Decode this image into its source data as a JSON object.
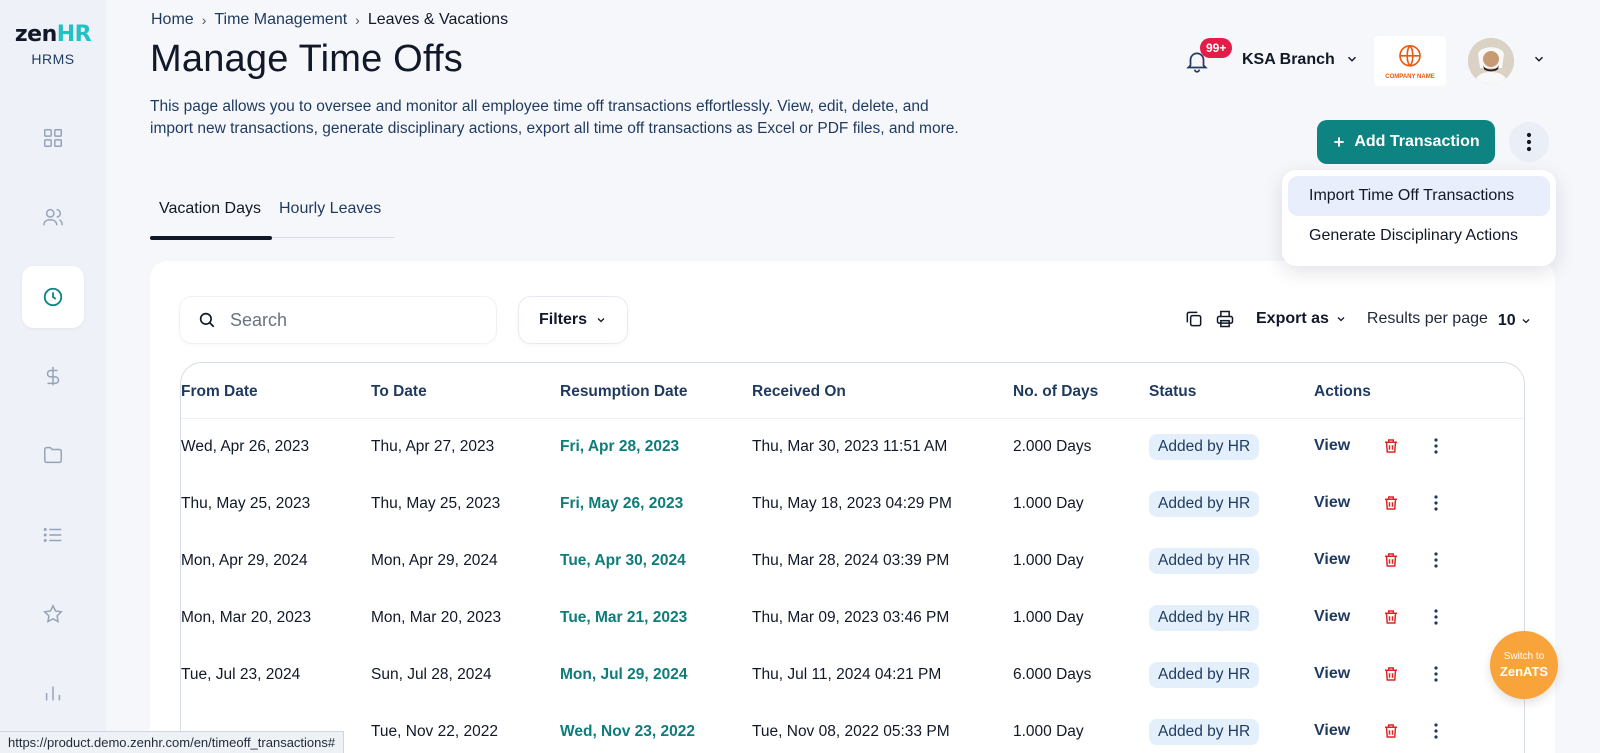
{
  "app": {
    "logo_text_main": "zen",
    "logo_text_accent": "HR",
    "logo_sub": "HRMS"
  },
  "breadcrumb": [
    "Home",
    "Time Management",
    "Leaves & Vacations"
  ],
  "page": {
    "title": "Manage Time Offs",
    "description": "This page allows you to oversee and monitor all employee time off transactions effortlessly. View, edit, delete, and import new transactions, generate disciplinary actions, export all time off transactions as Excel or PDF files, and more."
  },
  "header": {
    "notification_count": "99+",
    "branch": "KSA Branch",
    "company_logo_text": "COMPANY NAME"
  },
  "actions": {
    "add_transaction": "Add Transaction",
    "menu_items": [
      "Import Time Off Transactions",
      "Generate Disciplinary Actions"
    ]
  },
  "tabs": [
    "Vacation Days",
    "Hourly Leaves"
  ],
  "toolbar": {
    "search_placeholder": "Search",
    "filters": "Filters",
    "export_as": "Export as",
    "results_per_page_label": "Results per page",
    "results_per_page_value": "10"
  },
  "table": {
    "columns": [
      "From Date",
      "To Date",
      "Resumption Date",
      "Received On",
      "No. of Days",
      "Status",
      "Actions"
    ],
    "view_label": "View",
    "rows": [
      {
        "from": "Wed, Apr 26, 2023",
        "to": "Thu, Apr 27, 2023",
        "resumption": "Fri, Apr 28, 2023",
        "received": "Thu, Mar 30, 2023 11:51 AM",
        "days": "2.000 Days",
        "status": "Added by HR"
      },
      {
        "from": "Thu, May 25, 2023",
        "to": "Thu, May 25, 2023",
        "resumption": "Fri, May 26, 2023",
        "received": "Thu, May 18, 2023 04:29 PM",
        "days": "1.000 Day",
        "status": "Added by HR"
      },
      {
        "from": "Mon, Apr 29, 2024",
        "to": "Mon, Apr 29, 2024",
        "resumption": "Tue, Apr 30, 2024",
        "received": "Thu, Mar 28, 2024 03:39 PM",
        "days": "1.000 Day",
        "status": "Added by HR"
      },
      {
        "from": "Mon, Mar 20, 2023",
        "to": "Mon, Mar 20, 2023",
        "resumption": "Tue, Mar 21, 2023",
        "received": "Thu, Mar 09, 2023 03:46 PM",
        "days": "1.000 Day",
        "status": "Added by HR"
      },
      {
        "from": "Tue, Jul 23, 2024",
        "to": "Sun, Jul 28, 2024",
        "resumption": "Mon, Jul 29, 2024",
        "received": "Thu, Jul 11, 2024 04:21 PM",
        "days": "6.000 Days",
        "status": "Added by HR"
      },
      {
        "from": "",
        "to": "Tue, Nov 22, 2022",
        "resumption": "Wed, Nov 23, 2022",
        "received": "Tue, Nov 08, 2022 05:33 PM",
        "days": "1.000 Day",
        "status": "Added by HR"
      }
    ]
  },
  "floating": {
    "switch_small": "Switch to",
    "switch_big": "ZenATS"
  },
  "status_url": "https://product.demo.zenhr.com/en/timeoff_transactions#",
  "colors": {
    "primary": "#0e8482",
    "accent_resumption": "#0e7c7a",
    "badge_red": "#e11d48",
    "status_bg": "#e3f0fb",
    "zenats": "#f9a43a",
    "trash": "#dc2626"
  },
  "icons": {
    "nav": [
      "dashboard-icon",
      "people-icon",
      "clock-icon",
      "dollar-icon",
      "folder-icon",
      "list-icon",
      "star-icon",
      "chart-icon"
    ]
  }
}
